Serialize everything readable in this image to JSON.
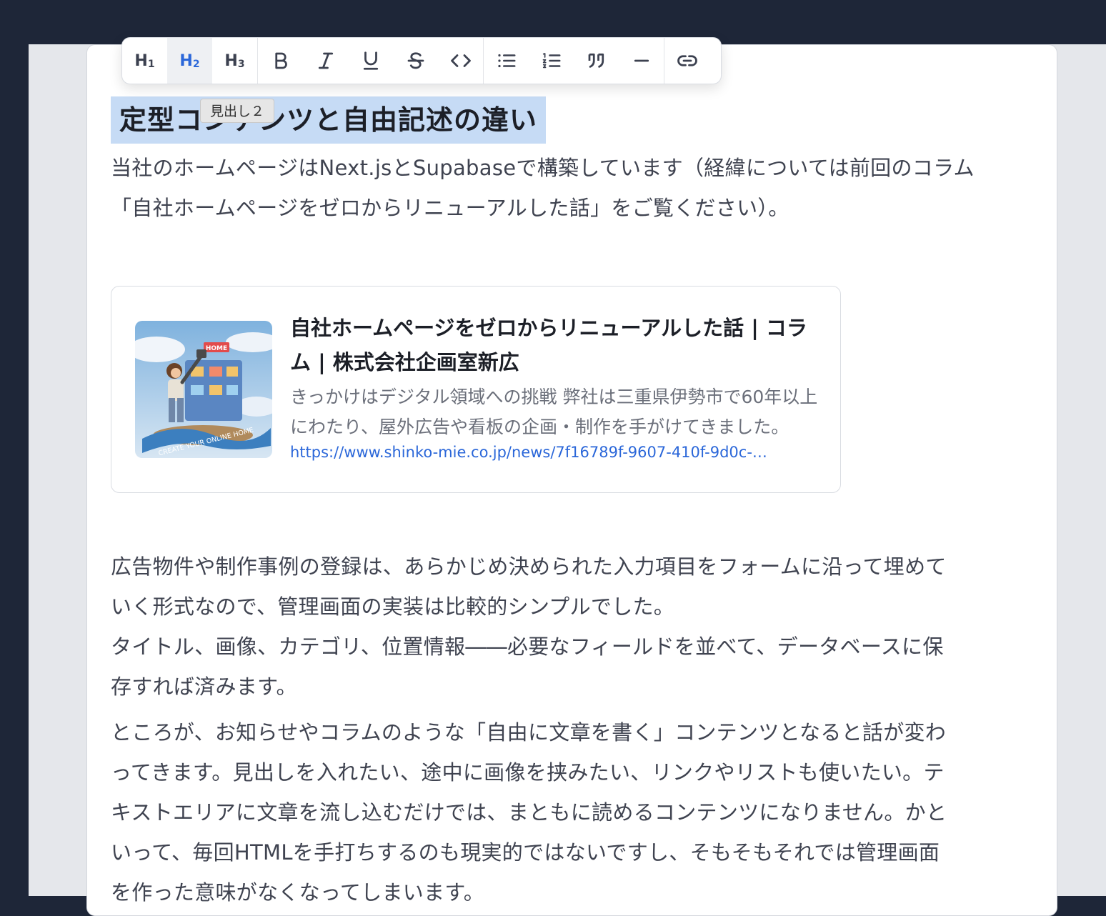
{
  "toolbar": {
    "buttons": [
      {
        "label": "H1",
        "level": "1",
        "active": false
      },
      {
        "label": "H2",
        "level": "2",
        "active": true
      },
      {
        "label": "H3",
        "level": "3",
        "active": false
      }
    ],
    "tooltip": "見出し２"
  },
  "document": {
    "heading": "定型コンテンツと自由記述の違い",
    "intro_line1": "当社のホームページはNext.jsとSupabaseで構築しています（経緯については前回のコラム",
    "intro_line2": "「自社ホームページをゼロからリニューアルした話」をご覧ください）。",
    "link_card": {
      "title": "自社ホームページをゼロからリニューアルした話 | コラム | 株式会社企画室新広",
      "description": "きっかけはデジタル領域への挑戦 弊社は三重県伊勢市で60年以上にわたり、屋外広告や看板の企画・制作を手がけてきました。",
      "url": "https://www.shinko-mie.co.jp/news/7f16789f-9607-410f-9d0c-…",
      "image_text": "CREATE YOUR ONLINE HOME",
      "image_sign": "HOME"
    },
    "para2_l1": "広告物件や制作事例の登録は、あらかじめ決められた入力項目をフォームに沿って埋めて",
    "para2_l2": "いく形式なので、管理画面の実装は比較的シンプルでした。",
    "para2_l3": "タイトル、画像、カテゴリ、位置情報――必要なフィールドを並べて、データベースに保",
    "para2_l4": "存すれば済みます。",
    "para3_l1": "ところが、お知らせやコラムのような「自由に文章を書く」コンテンツとなると話が変わ",
    "para3_l2": "ってきます。見出しを入れたい、途中に画像を挟みたい、リンクやリストも使いたい。テ",
    "para3_l3": "キストエリアに文章を流し込むだけでは、まともに読めるコンテンツになりません。かと",
    "para3_l4": "いって、毎回HTMLを手打ちするのも現実的ではないですし、そもそもそれでは管理画面",
    "para3_l5": "を作った意味がなくなってしまいます。"
  },
  "colors": {
    "accent": "#2b67d9",
    "selection": "#c6dbf5",
    "frame": "#1e2638"
  }
}
